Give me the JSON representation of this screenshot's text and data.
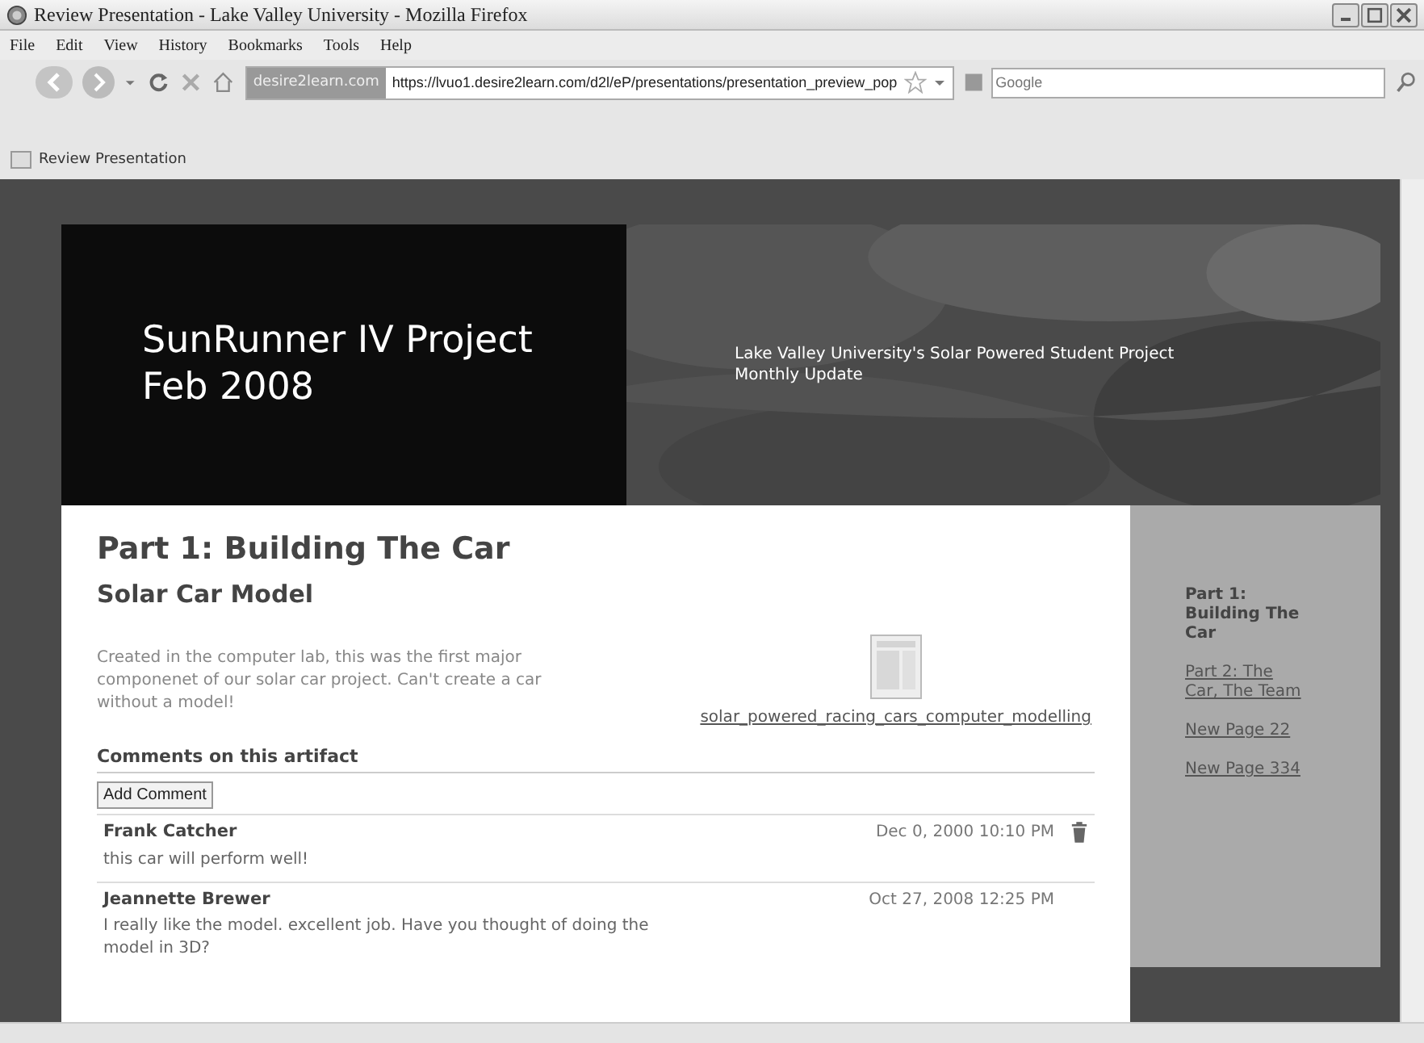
{
  "window": {
    "title": "Review Presentation - Lake Valley University - Mozilla Firefox"
  },
  "menu": [
    {
      "label": "File"
    },
    {
      "label": "Edit"
    },
    {
      "label": "View"
    },
    {
      "label": "History"
    },
    {
      "label": "Bookmarks"
    },
    {
      "label": "Tools"
    },
    {
      "label": "Help"
    }
  ],
  "address_bar": {
    "site_badge": "desire2learn.com",
    "url": "https://lvuo1.desire2learn.com/d2l/eP/presentations/presentation_preview_pop"
  },
  "search": {
    "placeholder": "Google"
  },
  "tab": {
    "label": "Review Presentation"
  },
  "banner": {
    "title": "SunRunner IV Project\nFeb 2008",
    "subtitle": "Lake Valley University's Solar Powered Student Project\nMonthly Update"
  },
  "page": {
    "heading": "Part 1: Building The Car",
    "artifact_title": "Solar Car Model",
    "description": "Created in the computer lab, this was the first major componenet of our solar car project. Can't create a car without a model!",
    "file_link": "solar_powered_racing_cars_computer_modelling"
  },
  "comments": {
    "heading": "Comments on this artifact",
    "add_button": "Add Comment",
    "items": [
      {
        "author": "Frank Catcher",
        "date": "Dec 0, 2000 10:10 PM",
        "text": "this car will perform well!",
        "deletable": true
      },
      {
        "author": "Jeannette Brewer",
        "date": "Oct 27, 2008 12:25 PM",
        "text": "I really like the model. excellent job. Have you thought of doing the model in 3D?",
        "deletable": false
      }
    ]
  },
  "sidebar": {
    "items": [
      {
        "label": "Part 1: Building The Car",
        "selected": true
      },
      {
        "label": "Part 2: The Car, The Team",
        "selected": false
      },
      {
        "label": "New Page 22",
        "selected": false
      },
      {
        "label": "New Page 334",
        "selected": false
      }
    ]
  }
}
